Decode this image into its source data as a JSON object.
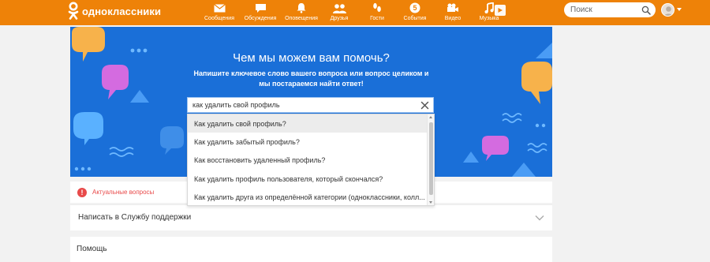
{
  "header": {
    "brand": "одноклассники",
    "nav": [
      {
        "label": "Сообщения",
        "icon": "envelope-icon"
      },
      {
        "label": "Обсуждения",
        "icon": "discussion-bubble-icon"
      },
      {
        "label": "Оповещения",
        "icon": "bell-icon"
      },
      {
        "label": "Друзья",
        "icon": "friends-icon"
      },
      {
        "label": "Гости",
        "icon": "footprints-icon"
      },
      {
        "label": "События",
        "icon": "events-badge-icon"
      },
      {
        "label": "Видео",
        "icon": "video-camera-icon"
      },
      {
        "label": "Музыка",
        "icon": "music-note-icon"
      }
    ],
    "search_placeholder": "Поиск"
  },
  "hero": {
    "title": "Чем мы можем вам помочь?",
    "subtitle": "Напишите ключевое слово вашего вопроса или вопрос целиком и мы постараемся найти ответ!",
    "query": "как удалить свой профиль"
  },
  "suggestions": [
    "Как удалить свой профиль?",
    "Как удалить забытый профиль?",
    "Как восстановить удаленный профиль?",
    "Как удалить профиль пользователя, который скончался?",
    "Как удалить друга из определённой категории (одноклассники, колл..."
  ],
  "sections": {
    "actual_label": "Актуальные вопросы",
    "support_label": "Написать в Службу поддержки",
    "help_label": "Помощь"
  },
  "colors": {
    "brand_orange": "#ee8208",
    "hero_blue": "#1a6fd8",
    "alert_red": "#e84a4a"
  }
}
